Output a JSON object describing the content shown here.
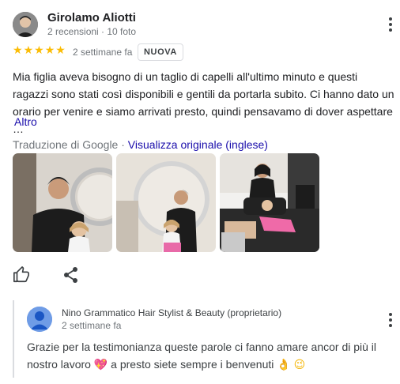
{
  "review": {
    "reviewer_name": "Girolamo Aliotti",
    "reviewer_meta": "2 recensioni · 10 foto",
    "rating": 5,
    "stars": "★★★★★",
    "date": "2 settimane fa",
    "badge": "NUOVA",
    "text": "Mia figlia aveva bisogno di un taglio di capelli all'ultimo minuto e questi ragazzi sono stati così disponibili e gentili da portarla subito. Ci hanno dato un orario per venire e siamo arrivati presto, quindi pensavamo di dover aspettare …",
    "more_label": "Altro",
    "translation_label": "Traduzione di Google · ",
    "original_link": "Visualizza originale (inglese)",
    "photos_count": 3
  },
  "icons": {
    "like": "thumb-up-icon",
    "share": "share-icon",
    "menu": "more-vert-icon",
    "star": "star-icon",
    "heart": "heart-emoji",
    "ok": "ok-hand-emoji",
    "wink": "winking-face-emoji"
  },
  "owner_reply": {
    "name": "Nino Grammatico Hair Stylist & Beauty (proprietario)",
    "date": "2 settimane fa",
    "text_1": "Grazie per la testimonianza queste parole ci fanno amare ancor di più il nostro lavoro ",
    "heart": "💖",
    "text_2": " a presto siete sempre i benvenuti ",
    "emoji_ok": "👌",
    "emoji_wink": "😉"
  },
  "colors": {
    "star": "#fbbc04",
    "link": "#1a0dab",
    "secondary_text": "#70757a",
    "owner_avatar": "#6f9ce6"
  }
}
